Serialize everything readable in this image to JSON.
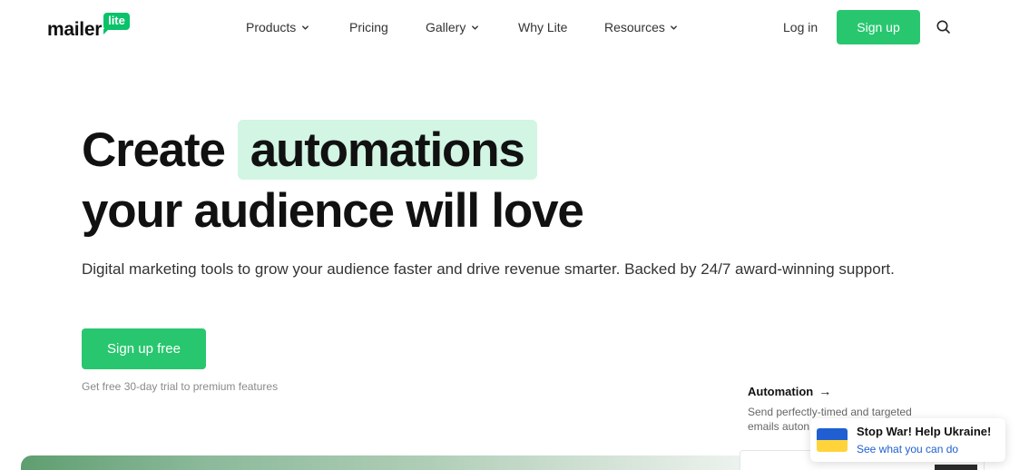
{
  "header": {
    "logo": {
      "word": "mailer",
      "badge": "lite"
    },
    "nav": [
      {
        "label": "Products",
        "has_dropdown": true
      },
      {
        "label": "Pricing",
        "has_dropdown": false
      },
      {
        "label": "Gallery",
        "has_dropdown": true
      },
      {
        "label": "Why Lite",
        "has_dropdown": false
      },
      {
        "label": "Resources",
        "has_dropdown": true
      }
    ],
    "login_label": "Log in",
    "signup_label": "Sign up",
    "search_icon": "search-icon"
  },
  "hero": {
    "title_prefix": "Create",
    "title_highlight": "automations",
    "title_line2": "your audience will love",
    "subtitle": "Digital marketing tools to grow your audience faster and drive revenue smarter. Backed by 24/7 award-winning support.",
    "cta_label": "Sign up free",
    "trial_note": "Get free 30-day trial to premium features"
  },
  "feature": {
    "title": "Automation",
    "arrow": "→",
    "description": "Send perfectly-timed and targeted emails auton"
  },
  "ukraine_banner": {
    "title": "Stop War! Help Ukraine!",
    "link": "See what you can do"
  },
  "colors": {
    "brand_green": "#28c76f",
    "logo_green": "#09c269",
    "highlight": "#d2f5e4",
    "link_blue": "#1f5fd1",
    "flag_blue": "#1f5fd1",
    "flag_yellow": "#ffd43b"
  }
}
